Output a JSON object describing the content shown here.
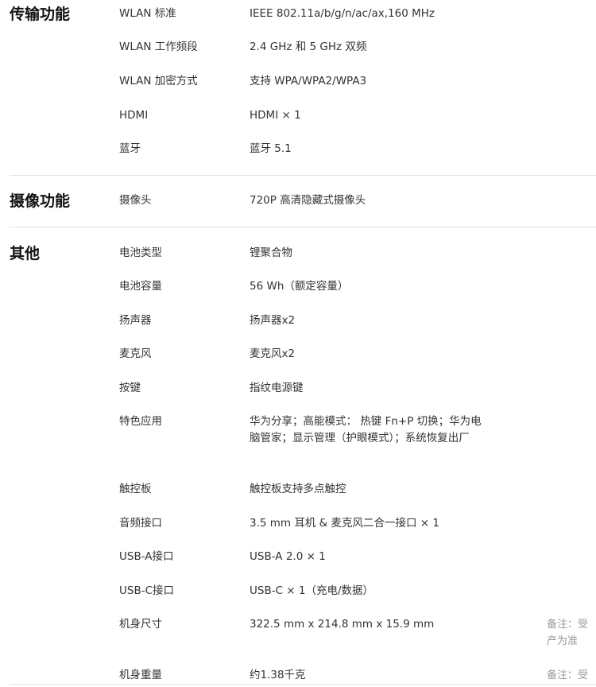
{
  "sections": [
    {
      "title": "传输功能",
      "rows": [
        {
          "label": "WLAN 标准",
          "value": "IEEE 802.11a/b/g/n/ac/ax,160 MHz"
        },
        {
          "label": "WLAN 工作频段",
          "value": "2.4 GHz 和 5 GHz 双频"
        },
        {
          "label": "WLAN 加密方式",
          "value": "支持 WPA/WPA2/WPA3"
        },
        {
          "label": "HDMI",
          "value": "HDMI × 1"
        },
        {
          "label": "蓝牙",
          "value": "蓝牙 5.1"
        }
      ]
    },
    {
      "title": "摄像功能",
      "rows": [
        {
          "label": "摄像头",
          "value": "720P 高清隐藏式摄像头"
        }
      ]
    },
    {
      "title": "其他",
      "rows": [
        {
          "label": "电池类型",
          "value": "锂聚合物"
        },
        {
          "label": "电池容量",
          "value": "56 Wh（额定容量）"
        },
        {
          "label": "扬声器",
          "value": "扬声器x2"
        },
        {
          "label": "麦克风",
          "value": "麦克风x2"
        },
        {
          "label": "按键",
          "value": "指纹电源键"
        },
        {
          "label": "特色应用",
          "value": "华为分享；高能模式： 热键 Fn+P 切换；华为电脑管家；显示管理（护眼模式）；系统恢复出厂"
        },
        {
          "label": "触控板",
          "value": "触控板支持多点触控"
        },
        {
          "label": "音频接口",
          "value": "3.5 mm 耳机 & 麦克风二合一接口 × 1"
        },
        {
          "label": "USB-A接口",
          "value": "USB-A 2.0 × 1"
        },
        {
          "label": "USB-C接口",
          "value": "USB-C × 1（充电/数据）"
        },
        {
          "label": "机身尺寸",
          "value": "322.5 mm x 214.8 mm x 15.9 mm",
          "note": "备注：受产为准"
        },
        {
          "label": "机身重量",
          "value": "约1.38千克",
          "note": "备注：受产"
        }
      ]
    }
  ]
}
